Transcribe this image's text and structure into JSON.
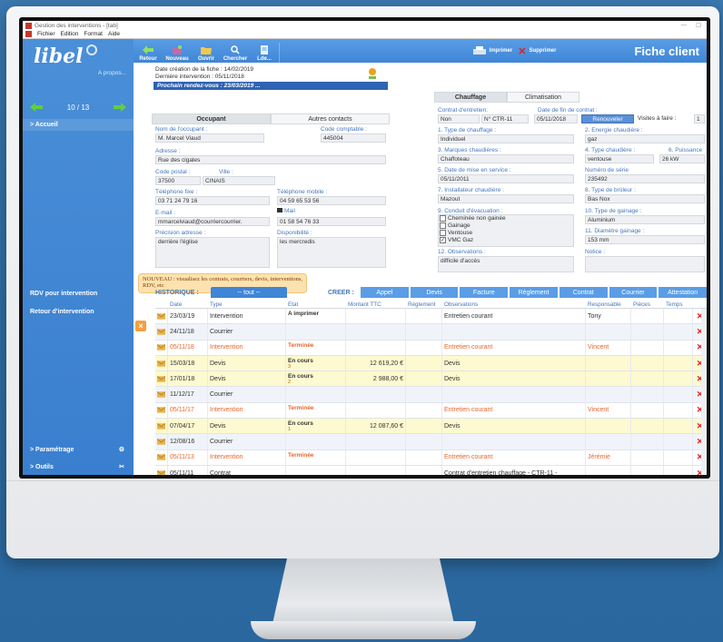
{
  "window": {
    "title": "Gestion des interventions - [tab]",
    "menu": [
      "Fichier",
      "Edition",
      "Format",
      "Aide"
    ]
  },
  "sidebar": {
    "logo": "libel",
    "apropos": "A propos...",
    "record_counter": "10 / 13",
    "items": {
      "accueil": "> Accueil",
      "rdv": "RDV pour intervention",
      "retour": "Retour d'intervention",
      "parametrage": "> Paramétrage",
      "outils": "> Outils"
    }
  },
  "toolbar": {
    "buttons": [
      "Retour",
      "Nouveau",
      "Ouvrir",
      "Chercher",
      "Lde..."
    ],
    "imprimer": "Imprimer",
    "supprimer": "Supprimer",
    "title": "Fiche client"
  },
  "client": {
    "date_creation": "Date création de la fiche : 14/02/2019",
    "derniere_intervention": "Dernière intervention :  05/11/2018",
    "prochain_rdv": "Prochain rendez-vous :      23/03/2019 ...",
    "tabs": [
      "Occupant",
      "Autres contacts"
    ],
    "nom_label": "Nom de l'occupant :",
    "nom": "M. Marcel Viaud",
    "code_label": "Code comptable :",
    "code": "445004",
    "adresse_label": "Adresse :",
    "adresse": "Rue des cigales",
    "cp_label": "Code postal :",
    "cp": "37500",
    "ville_label": "Ville :",
    "ville": "CINAIS",
    "tel_fixe_label": "Téléphone fixe :",
    "tel_fixe": "03 71 24 79 16",
    "tel_mobile_label": "Téléphone mobile :",
    "tel_mobile": "04 59 65 53 56",
    "email_label": "E-mail :",
    "email": "mmarcelviaud@courriercourrier.",
    "mail_label": "Mail",
    "fax": "01 58 54 76 33",
    "precision_label": "Précision adresse :",
    "precision": "derrière l'église",
    "dispo_label": "Disponibilité :",
    "dispo": "les mercredis"
  },
  "chauffage": {
    "tabs": [
      "Chauffage",
      "Climatisation"
    ],
    "contrat_label": "Contrat d'entretien:",
    "contrat": "Non",
    "contrat_num": "N° CTR-11",
    "fin_label": "Date de fin de contrat :",
    "fin": "05/11/2018",
    "renouveler": "Renouveler",
    "visites_label": "Visites à faire :",
    "visites": "1",
    "f1_label": "1. Type de chauffage :",
    "f1": "Individuel",
    "f2_label": "2. Energie chaudière :",
    "f2": "gaz",
    "f3_label": "3. Marques chaudières :",
    "f3": "Chaffoteau",
    "f4_label": "4. Type chaudière :",
    "f4": "ventouse",
    "f6_label": "6. Puissance",
    "f6": "26 kW",
    "f5_label": "5. Date de mise en service :",
    "f5": "05/11/2011",
    "serie_label": "Numéro de série",
    "serie": "235492",
    "f7_label": "7. Installateur chaudière :",
    "f7": "Mazout",
    "f8_label": "8. Type de brûleur :",
    "f8": "Bas Nox",
    "f9_label": "9. Conduit d'évacuation :",
    "f9_opts": [
      "Cheminée non gainée",
      "Gainage",
      "Ventouse",
      "VMC Gaz"
    ],
    "f9_checked": "VMC Gaz",
    "f10_label": "10. Type de gainage :",
    "f10": "Aluminium",
    "f11_label": "11. Diamètre gainage :",
    "f11": "153 mm",
    "f12_label": "12. Observations :",
    "f12": "difficile d'accès",
    "notice_label": "Notice :"
  },
  "history": {
    "nouveau_text": "NOUVEAU : visualisez les contrats, courriers, devis, interventions, RDV, etc",
    "historique_label": "HISTORIQUE :",
    "filter": "-- tout --",
    "creer_label": "CREER :",
    "creer_buttons": [
      "Appel",
      "Devis",
      "Facture",
      "Règlement",
      "Contrat",
      "Courrier",
      "Attestation"
    ],
    "columns": [
      "Date",
      "Type",
      "Etat",
      "Montant TTC",
      "Règlement",
      "Observations",
      "Responsable",
      "Pièces",
      "Temps"
    ],
    "rows": [
      {
        "date": "23/03/19",
        "type": "Intervention",
        "etat": "A imprimer",
        "etat_sub": "",
        "montant": "",
        "obs": "Entretien courant",
        "resp": "Tony",
        "style": "normal"
      },
      {
        "date": "24/11/18",
        "type": "Courrier",
        "etat": "",
        "etat_sub": "",
        "montant": "",
        "obs": "",
        "resp": "",
        "style": "blue"
      },
      {
        "date": "05/11/18",
        "type": "Intervention",
        "etat": "Terminée",
        "etat_sub": "",
        "montant": "",
        "obs": "Entretien courant",
        "resp": "Vincent",
        "style": "done"
      },
      {
        "date": "15/03/18",
        "type": "Devis",
        "etat": "En cours",
        "etat_sub": "3",
        "montant": "12 619,20 €",
        "obs": "Devis",
        "resp": "",
        "style": "yellow"
      },
      {
        "date": "17/01/18",
        "type": "Devis",
        "etat": "En cours",
        "etat_sub": "2",
        "montant": "2 988,00 €",
        "obs": "Devis",
        "resp": "",
        "style": "yellow"
      },
      {
        "date": "11/12/17",
        "type": "Courrier",
        "etat": "",
        "etat_sub": "",
        "montant": "",
        "obs": "",
        "resp": "",
        "style": "blue"
      },
      {
        "date": "05/11/17",
        "type": "Intervention",
        "etat": "Terminée",
        "etat_sub": "",
        "montant": "",
        "obs": "Entretien courant",
        "resp": "Vincent",
        "style": "done"
      },
      {
        "date": "07/04/17",
        "type": "Devis",
        "etat": "En cours",
        "etat_sub": "1",
        "montant": "12 087,60 €",
        "obs": "Devis",
        "resp": "",
        "style": "yellow"
      },
      {
        "date": "12/08/16",
        "type": "Courrier",
        "etat": "",
        "etat_sub": "",
        "montant": "",
        "obs": "",
        "resp": "",
        "style": "blue"
      },
      {
        "date": "05/11/13",
        "type": "Intervention",
        "etat": "Terminée",
        "etat_sub": "",
        "montant": "",
        "obs": "Entretien courant",
        "resp": "Jérémie",
        "style": "done"
      },
      {
        "date": "05/11/11",
        "type": "Contrat",
        "etat": "",
        "etat_sub": "",
        "montant": "",
        "obs": "Contrat d'entretien chauffage - CTR-11 -",
        "resp": "",
        "style": "normal"
      }
    ]
  }
}
